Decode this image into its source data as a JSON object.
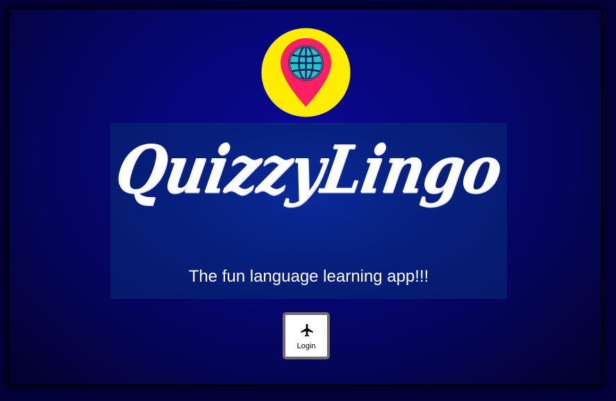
{
  "app": {
    "title": "QuizzyLingo",
    "tagline": "The fun language learning app!!!"
  },
  "logo": {
    "icon": "globe-map-pin-icon",
    "colors": {
      "circle": "#ffed00",
      "pin": "#ff1f63",
      "globe": "#1fc7c7",
      "globe_lines": "#1a1a5e"
    }
  },
  "login": {
    "label": "Login",
    "icon": "airplane-icon"
  },
  "colors": {
    "background": "#07067a",
    "banner": "#07207e",
    "text": "#ffffff"
  }
}
